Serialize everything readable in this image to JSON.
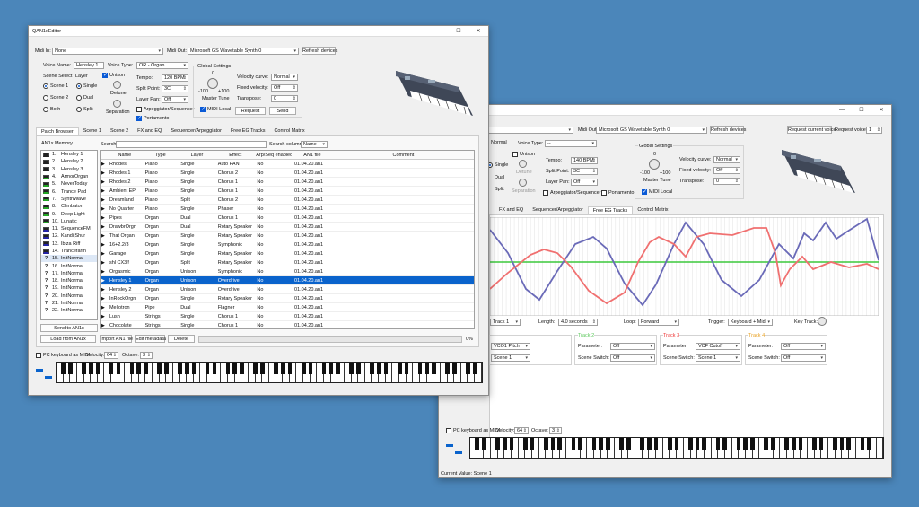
{
  "win1": {
    "title": "QAN1xEditor",
    "midi_in_label": "Midi In:",
    "midi_in_value": "None",
    "midi_out_label": "Midi Out:",
    "midi_out_value": "Microsoft GS Wavetable Synth 0",
    "refresh_label": "Refresh devices",
    "voice_name_label": "Voice Name:",
    "voice_name_value": "Hensley 1",
    "voice_type_label": "Voice Type:",
    "voice_type_value": "OR - Organ",
    "scene_select_label": "Scene Select",
    "scene1": "Scene 1",
    "scene2": "Scene 2",
    "both": "Both",
    "layer_label": "Layer",
    "single": "Single",
    "dual": "Dual",
    "split": "Split",
    "unison": "Unison",
    "detune": "Detune",
    "separation": "Separation",
    "tempo_label": "Tempo:",
    "tempo_value": "120 BPM",
    "split_point_label": "Split Point:",
    "split_point_value": "3C",
    "layer_pan_label": "Layer Pan:",
    "layer_pan_value": "Off",
    "arp_seq": "Arpeggiator/Sequencer",
    "portamento": "Portamento",
    "global_settings": "Global Settings",
    "master_tune": "Master Tune",
    "mt_zero": "0",
    "mt_min": "-100",
    "mt_max": "+100",
    "velocity_curve_label": "Velocity curve:",
    "velocity_curve_value": "Normal",
    "fixed_velocity_label": "Fixed velocity:",
    "fixed_velocity_value": "Off",
    "transpose_label": "Transpose:",
    "transpose_value": "0",
    "midi_local": "MIDI Local",
    "request": "Request",
    "send": "Send",
    "tabs": [
      "Patch Browser",
      "Scene 1",
      "Scene 2",
      "FX and EQ",
      "Sequencer/Arpeggiator",
      "Free EG Tracks",
      "Control Matrix"
    ],
    "memory_label": "AN1x Memory",
    "memory_items": [
      {
        "n": "1.",
        "name": "Hensley 1",
        "c": "#222"
      },
      {
        "n": "2.",
        "name": "Hensley 2",
        "c": "#222"
      },
      {
        "n": "3.",
        "name": "Hensley 3",
        "c": "#222"
      },
      {
        "n": "4.",
        "name": "ArmorOrgan",
        "c": "#2a2"
      },
      {
        "n": "5.",
        "name": "NeverToday",
        "c": "#2a2"
      },
      {
        "n": "6.",
        "name": "Trance Pad",
        "c": "#2a2"
      },
      {
        "n": "7.",
        "name": "SynthWave",
        "c": "#2a2"
      },
      {
        "n": "8.",
        "name": "Climbaton",
        "c": "#2a2"
      },
      {
        "n": "9.",
        "name": "Deep Light",
        "c": "#2a2"
      },
      {
        "n": "10.",
        "name": "Lunatic",
        "c": "#2a2"
      },
      {
        "n": "11.",
        "name": "SequenceFM",
        "c": "#22a"
      },
      {
        "n": "12.",
        "name": "Kandi|Shur",
        "c": "#22a"
      },
      {
        "n": "13.",
        "name": "Ibiza Riff",
        "c": "#22a"
      },
      {
        "n": "14.",
        "name": "Trancefarm",
        "c": "#22a"
      },
      {
        "n": "15.",
        "name": "InitNormal",
        "c": ""
      },
      {
        "n": "16.",
        "name": "InitNormal",
        "c": ""
      },
      {
        "n": "17.",
        "name": "InitNormal",
        "c": ""
      },
      {
        "n": "18.",
        "name": "InitNormal",
        "c": ""
      },
      {
        "n": "19.",
        "name": "InitNormal",
        "c": ""
      },
      {
        "n": "20.",
        "name": "InitNormal",
        "c": ""
      },
      {
        "n": "21.",
        "name": "InitNormal",
        "c": ""
      },
      {
        "n": "22.",
        "name": "InitNormal",
        "c": ""
      }
    ],
    "send_to_an1x": "Send to AN1x",
    "search_label": "Search:",
    "search_column_label": "Search column:",
    "search_column_value": "Name",
    "columns": [
      "Name",
      "Type",
      "Layer",
      "Effect",
      "Arp/Seq enabled",
      "AN1 file",
      "Comment"
    ],
    "rows": [
      [
        "Rhodes",
        "Piano",
        "Single",
        "Auto PAN",
        "No",
        "01.04.20.an1",
        ""
      ],
      [
        "Rhodes 1",
        "Piano",
        "Single",
        "Chorus 2",
        "No",
        "01.04.20.an1",
        ""
      ],
      [
        "Rhodes 2",
        "Piano",
        "Single",
        "Chorus 1",
        "No",
        "01.04.20.an1",
        ""
      ],
      [
        "Ambient EP",
        "Piano",
        "Single",
        "Chorus 1",
        "No",
        "01.04.20.an1",
        ""
      ],
      [
        "Dreamland",
        "Piano",
        "Split",
        "Chorus 2",
        "No",
        "01.04.20.an1",
        ""
      ],
      [
        "No Quarter",
        "Piano",
        "Single",
        "Phaser",
        "No",
        "01.04.20.an1",
        ""
      ],
      [
        "Pipes",
        "Organ",
        "Dual",
        "Chorus 1",
        "No",
        "01.04.20.an1",
        ""
      ],
      [
        "DrawbrOrgn",
        "Organ",
        "Dual",
        "Rotary Speaker",
        "No",
        "01.04.20.an1",
        ""
      ],
      [
        "That Organ",
        "Organ",
        "Single",
        "Rotary Speaker",
        "No",
        "01.04.20.an1",
        ""
      ],
      [
        "16+2.2/3",
        "Organ",
        "Single",
        "Symphonic",
        "No",
        "01.04.20.an1",
        ""
      ],
      [
        "Garage",
        "Organ",
        "Single",
        "Rotary Speaker",
        "No",
        "01.04.20.an1",
        ""
      ],
      [
        "shl CX3!!",
        "Organ",
        "Split",
        "Rotary Speaker",
        "No",
        "01.04.20.an1",
        ""
      ],
      [
        "Orgasmic",
        "Organ",
        "Unison",
        "Symphonic",
        "No",
        "01.04.20.an1",
        ""
      ],
      [
        "Hensley 1",
        "Organ",
        "Unison",
        "Overdrive",
        "No",
        "01.04.20.an1",
        ""
      ],
      [
        "Hensley 2",
        "Organ",
        "Unison",
        "Overdrive",
        "No",
        "01.04.20.an1",
        ""
      ],
      [
        "InRockOrgn",
        "Organ",
        "Single",
        "Rotary Speaker",
        "No",
        "01.04.20.an1",
        ""
      ],
      [
        "Mellotron",
        "Pipe",
        "Dual",
        "Flagner",
        "No",
        "01.04.20.an1",
        ""
      ],
      [
        "Lush",
        "Strings",
        "Single",
        "Chorus 1",
        "No",
        "01.04.20.an1",
        ""
      ],
      [
        "Chocolate",
        "Strings",
        "Single",
        "Chorus 1",
        "No",
        "01.04.20.an1",
        ""
      ]
    ],
    "selected_row": 13,
    "load_from": "Load from AN1x",
    "import": "Import AN1 file",
    "edit_meta": "Edit metadata",
    "delete": "Delete",
    "progress": "0%",
    "progress_value": 0,
    "pc_kbd": "PC keyboard as MIDI",
    "velocity_label": "Velocity:",
    "velocity_value": "64",
    "octave_label": "Octave:",
    "octave_value": "3"
  },
  "win2": {
    "scene_normal": "Normal",
    "voice_type_label": "Voice Type:",
    "voice_type_value": "--",
    "midi_out_label": "Midi Out:",
    "midi_out_value": "Microsoft GS Wavetable Synth 0",
    "refresh_label": "Refresh devices",
    "request_current": "Request current voice",
    "request_voice_label": "Request voice:",
    "request_voice_value": "1",
    "single": "Single",
    "dual": "Dual",
    "split": "Split",
    "unison": "Unison",
    "detune": "Detune",
    "separation": "Separation",
    "tempo_label": "Tempo:",
    "tempo_value": "140 BPM",
    "split_point_label": "Split Point:",
    "split_point_value": "3C",
    "layer_pan_label": "Layer Pan:",
    "layer_pan_value": "Off",
    "arp_seq": "Arpeggiator/Sequencer",
    "portamento": "Portamento",
    "global_settings": "Global Settings",
    "master_tune": "Master Tune",
    "mt_zero": "0",
    "mt_min": "-100",
    "mt_max": "+100",
    "velocity_curve_label": "Velocity curve:",
    "velocity_curve_value": "Normal",
    "fixed_velocity_label": "Fixed velocity:",
    "fixed_velocity_value": "Off",
    "transpose_label": "Transpose:",
    "transpose_value": "0",
    "midi_local": "MIDI Local",
    "tabs": [
      "FX and EQ",
      "Sequencer/Arpeggiator",
      "Free EG Tracks",
      "Control Matrix"
    ],
    "track_select": "Track 1",
    "length_label": "Length:",
    "length_value": "4.0 seconds",
    "loop_label": "Loop:",
    "loop_value": "Forward",
    "trigger_label": "Trigger:",
    "trigger_value": "Keyboard + Midi",
    "key_track_label": "Key Track:",
    "tracks": [
      {
        "name": "",
        "color": "#000",
        "param": "VCO1 Pitch",
        "scene": "Scene 1"
      },
      {
        "name": "Track 2",
        "color": "#5cc85c",
        "param": "Off",
        "scene": "Off"
      },
      {
        "name": "Track 3",
        "color": "#e33",
        "param": "VCF Cutoff",
        "scene": "Scene 1"
      },
      {
        "name": "Track 4",
        "color": "#e8a020",
        "param": "Off",
        "scene": "Off"
      }
    ],
    "parameter_label": "Parameter:",
    "scene_switch_label": "Scene Switch:",
    "pc_kbd": "PC keyboard as MIDI",
    "velocity_label": "Velocity:",
    "velocity_value": "64",
    "octave_label": "Octave:",
    "octave_value": "3",
    "status": "Current Value: Scene 1"
  },
  "colors": {
    "accent": "#0a63cc",
    "track_blue": "#6a6ab8",
    "track_red": "#f07070",
    "track_green": "#3cc83c"
  }
}
